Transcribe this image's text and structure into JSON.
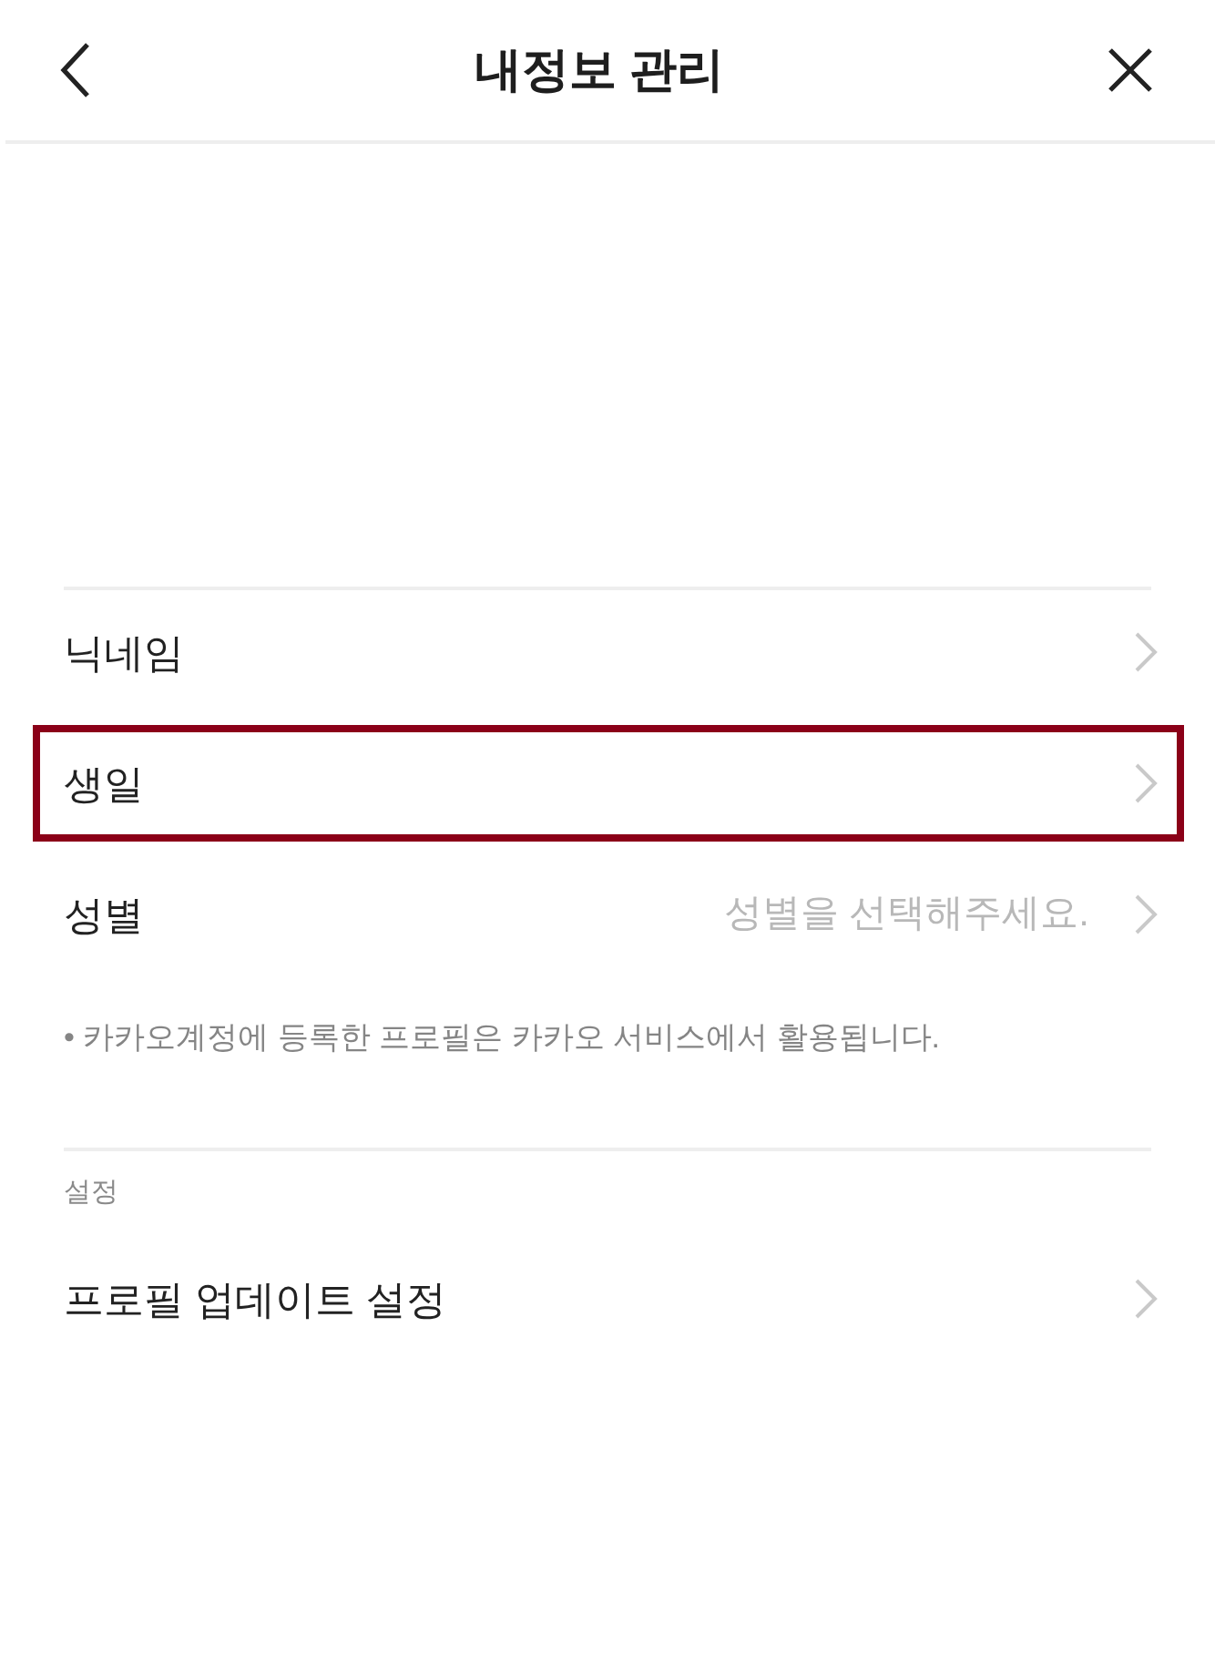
{
  "header": {
    "title": "내정보 관리"
  },
  "profile_items": [
    {
      "label": "닉네임",
      "highlighted": false
    },
    {
      "label": "생일",
      "highlighted": true
    },
    {
      "label": "성별",
      "value": "성별을 선택해주세요.",
      "highlighted": false
    }
  ],
  "note": "• 카카오계정에 등록한 프로필은 카카오 서비스에서 활용됩니다.",
  "settings_section": {
    "heading": "설정",
    "items": [
      {
        "label": "프로필 업데이트 설정",
        "highlighted": false
      }
    ]
  }
}
